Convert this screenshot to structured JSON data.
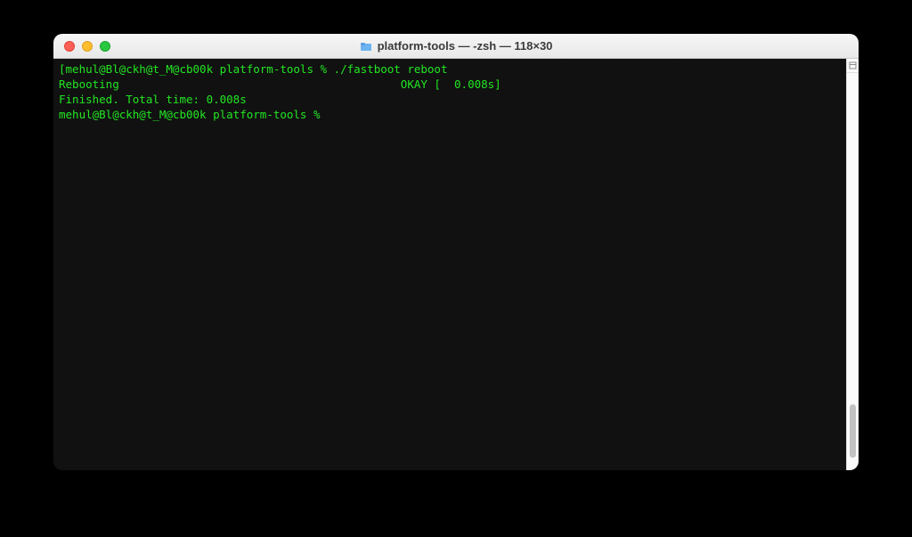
{
  "window": {
    "title": "platform-tools — -zsh — 118×30"
  },
  "terminal": {
    "lines": [
      "[mehul@Bl@ckh@t_M@cb00k platform-tools % ./fastboot reboot",
      "Rebooting                                          OKAY [  0.008s]",
      "Finished. Total time: 0.008s",
      "mehul@Bl@ckh@t_M@cb00k platform-tools % "
    ]
  }
}
